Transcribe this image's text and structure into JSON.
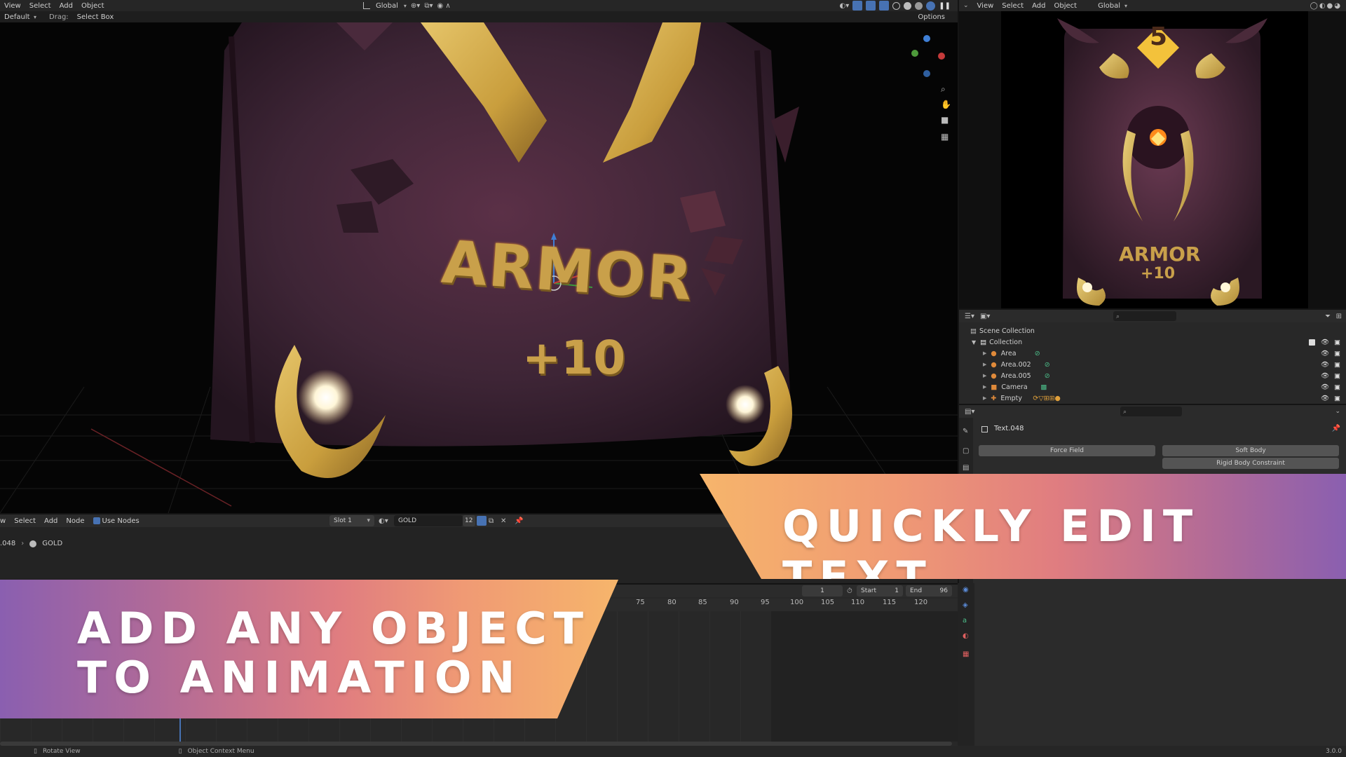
{
  "viewport": {
    "menu": [
      "View",
      "Select",
      "Add",
      "Object"
    ],
    "orientation": "Global",
    "header2": {
      "orientation_label": "Default",
      "drag_label": "Drag:",
      "drag_value": "Select Box",
      "options": "Options"
    },
    "card": {
      "title": "ARMOR",
      "bonus": "+10"
    }
  },
  "render_preview": {
    "menu": [
      "View",
      "Select",
      "Add",
      "Object"
    ],
    "orientation": "Global",
    "card": {
      "number": "5",
      "title": "ARMOR",
      "bonus": "+10"
    }
  },
  "outliner": {
    "scene_label": "Scene Collection",
    "collection_label": "Collection",
    "items": [
      {
        "name": "Area"
      },
      {
        "name": "Area.002"
      },
      {
        "name": "Area.005"
      },
      {
        "name": "Camera"
      },
      {
        "name": "Empty"
      }
    ]
  },
  "properties": {
    "object_name": "Text.048",
    "buttons": [
      "Force Field",
      "Soft Body",
      "Rigid Body Constraint"
    ]
  },
  "shader_editor": {
    "menu": [
      "w",
      "Select",
      "Add",
      "Node"
    ],
    "use_nodes_label": "Use Nodes",
    "slot": "Slot 1",
    "material": "GOLD",
    "users": "12",
    "breadcrumb_object": ".048",
    "breadcrumb_material": "GOLD"
  },
  "timeline": {
    "current_frame": "1",
    "start_label": "Start",
    "start_value": "1",
    "end_label": "End",
    "end_value": "96",
    "ticks": [
      "75",
      "80",
      "85",
      "90",
      "95",
      "100",
      "105",
      "110",
      "115",
      "120"
    ]
  },
  "status_bar": {
    "left": "Rotate View",
    "middle": "Object Context Menu",
    "version": "3.0.0"
  },
  "banners": {
    "right": "QUICKLY EDIT TEXT",
    "left_line1": "ADD ANY OBJECT",
    "left_line2": "TO ANIMATION"
  },
  "colors": {
    "accent": "#4772b3",
    "gold": "#c9a04a",
    "banner_orange": "#f6b56b",
    "banner_pink": "#ea7f7c",
    "banner_purple": "#8a5fb0"
  }
}
